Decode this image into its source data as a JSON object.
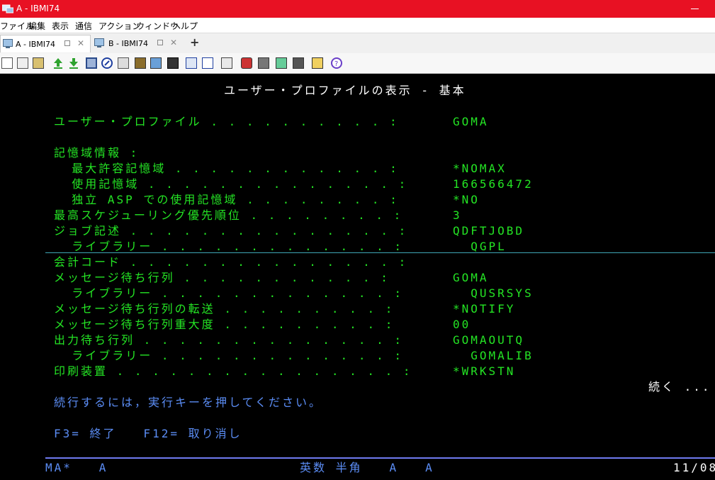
{
  "window": {
    "title": "A - IBMI74"
  },
  "menu": [
    "ファイル",
    "編集",
    "表示",
    "通信",
    "アクション",
    "ウィンドウ",
    "ヘルプ"
  ],
  "tabs": [
    {
      "label": "A - IBMI74",
      "active": true
    },
    {
      "label": "B - IBMI74",
      "active": false
    }
  ],
  "add_tab": "+",
  "toolbar_icons": [
    "copy-icon",
    "paste-icon",
    "print-icon",
    "upload-icon",
    "download-icon",
    "save-icon",
    "macro-record-icon",
    "notes-icon",
    "stack-icon",
    "transfer-icon",
    "keypad-icon",
    "terminal-icon",
    "keyboard-icon",
    "grid-icon",
    "macro-icon",
    "robot-icon",
    "printer-session-icon",
    "pause-icon",
    "run-icon",
    "stop-icon",
    "notepad-icon",
    "help-icon"
  ],
  "screen": {
    "title": "ユーザー・プロファイルの表示 - 基本",
    "rows": [
      {
        "label": "ユーザー・プロファイル . . . . . . . . . . :",
        "value": "GOMA"
      },
      {
        "label": "記憶域情報 :",
        "value": ""
      },
      {
        "label": "  最大許容記憶域 . . . . . . . . . . . . :",
        "value": "*NOMAX"
      },
      {
        "label": "  使用記憶域 . . . . . . . . . . . . . . :",
        "value": "166566472"
      },
      {
        "label": "  独立 ASP での使用記憶域 . . . . . . . . :",
        "value": "*NO"
      },
      {
        "label": "最高スケジューリング優先順位 . . . . . . . . :",
        "value": "3"
      },
      {
        "label": "ジョブ記述 . . . . . . . . . . . . . . . :",
        "value": "QDFTJOBD"
      },
      {
        "label": "  ライブラリー . . . . . . . . . . . . . :",
        "value": "  QGPL"
      },
      {
        "label": "会計コード . . . . . . . . . . . . . . . :",
        "value": ""
      },
      {
        "label": "メッセージ待ち行列 . . . . . . . . . . . :",
        "value": "GOMA"
      },
      {
        "label": "  ライブラリー . . . . . . . . . . . . . :",
        "value": "  QUSRSYS"
      },
      {
        "label": "メッセージ待ち行列の転送 . . . . . . . . . :",
        "value": "*NOTIFY"
      },
      {
        "label": "メッセージ待ち行列重大度 . . . . . . . . . :",
        "value": "00"
      },
      {
        "label": "出力待ち行列 . . . . . . . . . . . . . . :",
        "value": "GOMAOUTQ"
      },
      {
        "label": "  ライブラリー . . . . . . . . . . . . . :",
        "value": "  GOMALIB"
      },
      {
        "label": "印刷装置 . . . . . . . . . . . . . . . . :",
        "value": "*WRKSTN"
      }
    ],
    "more": "続く ...",
    "instruction": "続行するには，実行キーを押してください。",
    "function_keys": "F3= 終了   F12= 取り消し"
  },
  "statusbar": {
    "left": "MA*   A",
    "mode": "英数 半角   A   A",
    "cursor": "11/08"
  },
  "colors": {
    "titlebar": "#e81123",
    "field_green": "#24e424",
    "prompt_blue": "#5b8df5",
    "screen_bg": "#000000"
  }
}
